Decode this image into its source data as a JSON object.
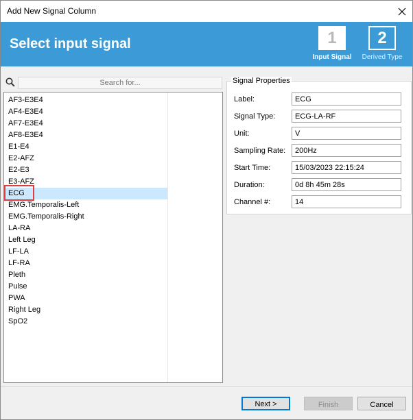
{
  "window": {
    "title": "Add New Signal Column"
  },
  "header": {
    "heading": "Select input signal",
    "steps": [
      {
        "number": "1",
        "caption": "Input Signal"
      },
      {
        "number": "2",
        "caption": "Derived Type"
      }
    ]
  },
  "search": {
    "placeholder": "Search for..."
  },
  "signals": [
    "AF3-E3E4",
    "AF4-E3E4",
    "AF7-E3E4",
    "AF8-E3E4",
    "E1-E4",
    "E2-AFZ",
    "E2-E3",
    "E3-AFZ",
    "ECG",
    "EMG.Temporalis-Left",
    "EMG.Temporalis-Right",
    "LA-RA",
    "Left Leg",
    "LF-LA",
    "LF-RA",
    "Pleth",
    "Pulse",
    "PWA",
    "Right Leg",
    "SpO2"
  ],
  "selected_signal": "ECG",
  "properties": {
    "legend": "Signal Properties",
    "rows": [
      {
        "label": "Label:",
        "value": "ECG"
      },
      {
        "label": "Signal Type:",
        "value": "ECG-LA-RF"
      },
      {
        "label": "Unit:",
        "value": "V"
      },
      {
        "label": "Sampling Rate:",
        "value": "200Hz"
      },
      {
        "label": "Start Time:",
        "value": "15/03/2023 22:15:24"
      },
      {
        "label": "Duration:",
        "value": "0d 8h 45m 28s"
      },
      {
        "label": "Channel #:",
        "value": "14"
      }
    ]
  },
  "buttons": {
    "next": "Next >",
    "finish": "Finish",
    "cancel": "Cancel"
  },
  "colors": {
    "header_bg": "#3c9bd7",
    "selection": "#cce8ff",
    "highlight_border": "#e23b3b"
  }
}
